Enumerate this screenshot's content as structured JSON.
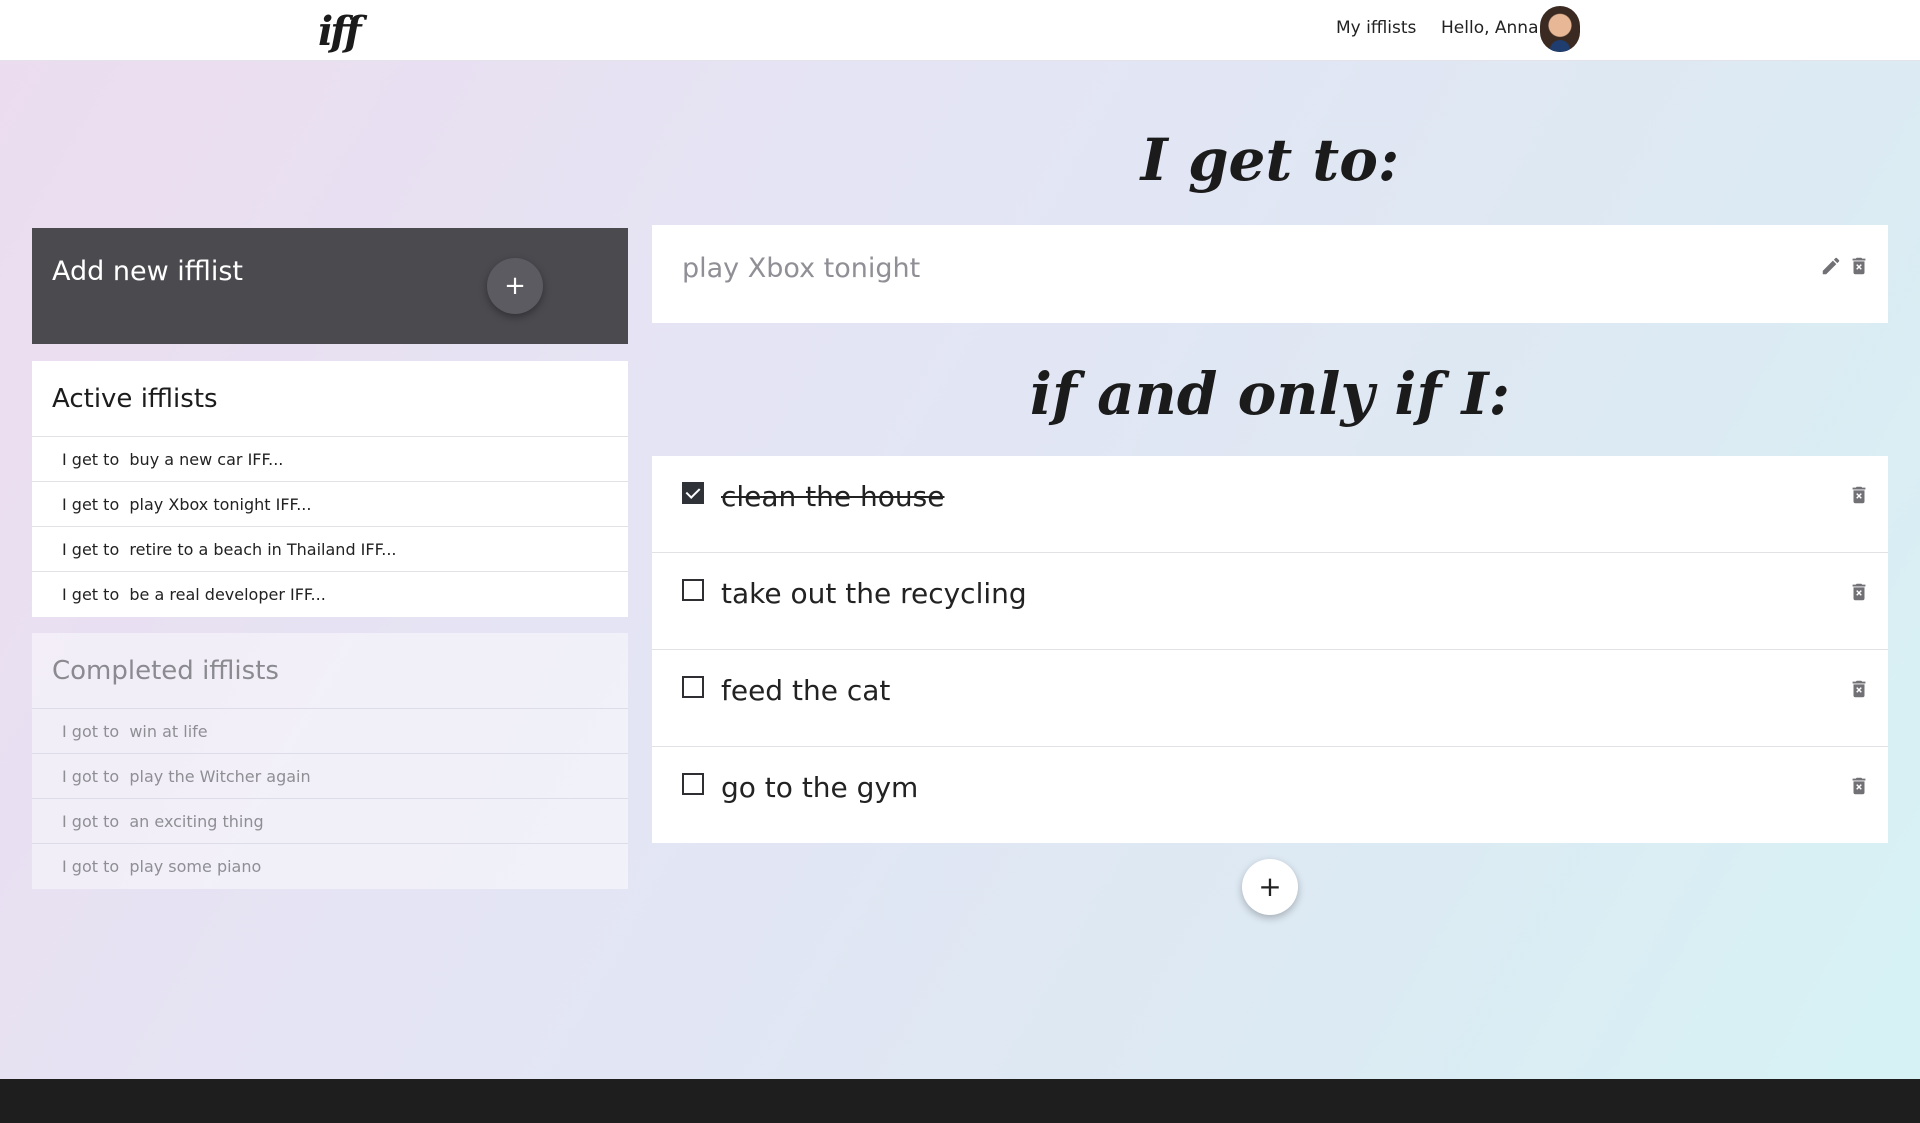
{
  "header": {
    "logo": "iff",
    "nav_my_ifflists": "My ifflists",
    "greeting": "Hello, Anna!"
  },
  "sidebar": {
    "add_title": "Add new ifflist",
    "add_button": "+",
    "active": {
      "title": "Active ifflists",
      "items": [
        {
          "label": "I get to  buy a new car IFF..."
        },
        {
          "label": "I get to  play Xbox tonight IFF..."
        },
        {
          "label": "I get to  retire to a beach in Thailand IFF..."
        },
        {
          "label": "I get to  be a real developer IFF..."
        }
      ]
    },
    "completed": {
      "title": "Completed ifflists",
      "items": [
        {
          "label": "I got to  win at life"
        },
        {
          "label": "I got to  play the Witcher again"
        },
        {
          "label": "I got to  an exciting thing"
        },
        {
          "label": "I got to  play some piano"
        }
      ]
    }
  },
  "main": {
    "goal_heading": "I get to:",
    "goal_text": "play Xbox tonight",
    "conditions_heading": "if and only if I:",
    "tasks": [
      {
        "text": "clean the house",
        "done": true
      },
      {
        "text": "take out the recycling",
        "done": false
      },
      {
        "text": "feed the cat",
        "done": false
      },
      {
        "text": "go to the gym",
        "done": false
      }
    ],
    "add_task_button": "+"
  },
  "icons": {
    "edit": "pencil-icon",
    "delete": "trash-icon",
    "checked": "checkbox-checked-icon",
    "unchecked": "checkbox-empty-icon"
  },
  "colors": {
    "add_card_bg": "#4b4a4f",
    "footer_bg": "#1e1e1f",
    "checkbox_checked": "#2f3338"
  }
}
